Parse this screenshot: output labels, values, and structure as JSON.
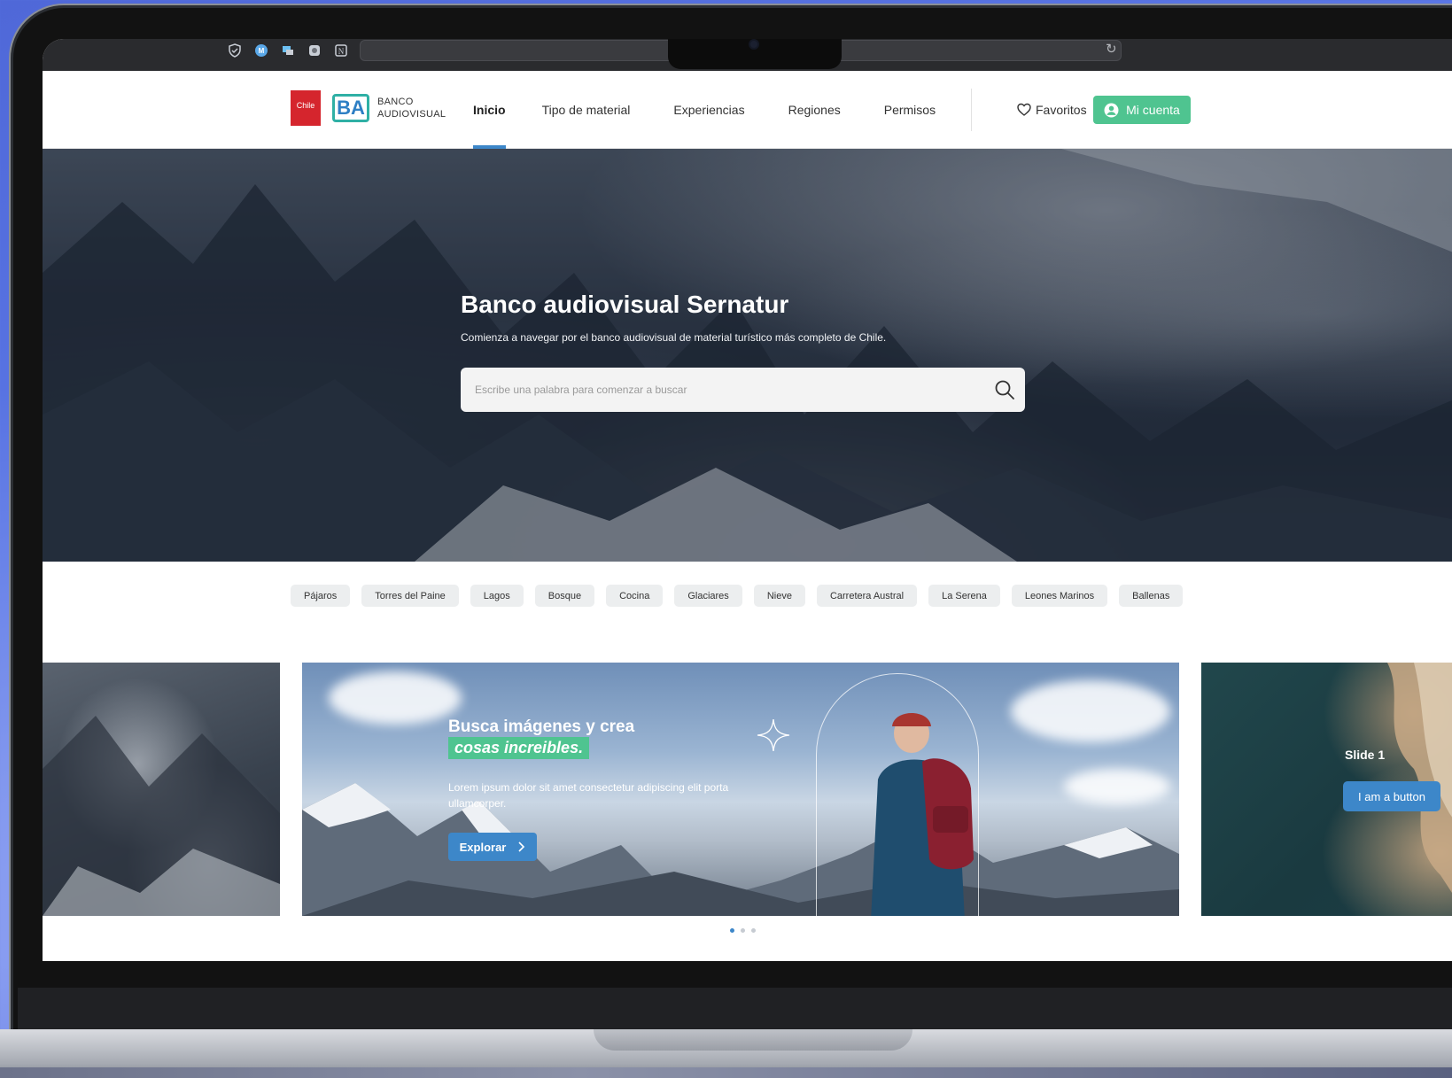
{
  "browser": {
    "extensions": [
      "shield-icon",
      "m-icon",
      "window-icon",
      "record-icon",
      "notion-icon"
    ],
    "reload_icon": "reload-icon"
  },
  "header": {
    "logo_chile_text": "Chile",
    "logo_ba_text": "BA",
    "logo_line1": "BANCO",
    "logo_line2": "AUDIOVISUAL",
    "nav": [
      {
        "label": "Inicio",
        "active": true
      },
      {
        "label": "Tipo de material",
        "active": false
      },
      {
        "label": "Experiencias",
        "active": false
      },
      {
        "label": "Regiones",
        "active": false
      },
      {
        "label": "Permisos",
        "active": false
      }
    ],
    "favorites_label": "Favoritos",
    "account_label": "Mi cuenta"
  },
  "hero": {
    "title": "Banco audiovisual Sernatur",
    "subtitle": "Comienza a navegar por el banco audiovisual de material turístico más completo de Chile.",
    "search_placeholder": "Escribe una palabra para comenzar a buscar"
  },
  "chips": [
    "Pájaros",
    "Torres del Paine",
    "Lagos",
    "Bosque",
    "Cocina",
    "Glaciares",
    "Nieve",
    "Carretera Austral",
    "La Serena",
    "Leones Marinos",
    "Ballenas"
  ],
  "carousel": {
    "main": {
      "title": "Busca imágenes y crea",
      "highlight": "cosas increibles.",
      "text": "Lorem ipsum dolor sit amet consectetur adipiscing elit porta ullamcorper.",
      "button": "Explorar"
    },
    "right": {
      "label": "Slide 1",
      "button": "I am a button"
    },
    "dots": 3,
    "active_dot": 0
  },
  "colors": {
    "primary_blue": "#3d87c9",
    "accent_green": "#4fc490",
    "chile_red": "#d5252d"
  }
}
